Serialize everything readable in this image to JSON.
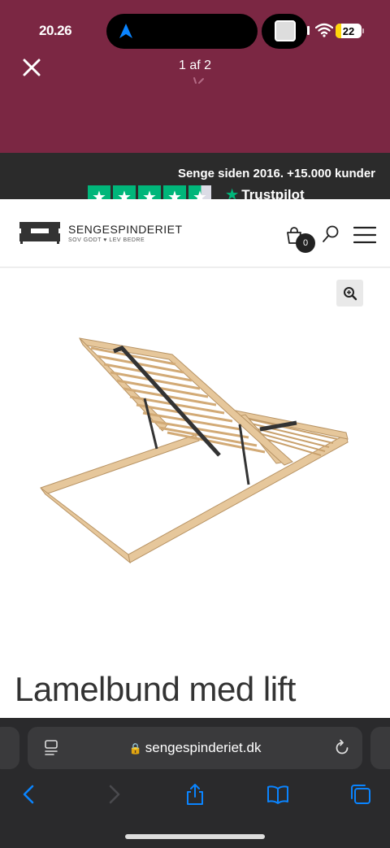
{
  "status_bar": {
    "time": "20.26",
    "battery": "22"
  },
  "viewer": {
    "counter": "1 af 2"
  },
  "promo": {
    "text": "Senge siden 2016. +15.000 kunder",
    "trustpilot": "Trustpilot"
  },
  "header": {
    "brand": "SENGESPINDERIET",
    "tagline": "SOV GODT ♥ LEV BEDRE",
    "cart_count": "0"
  },
  "product": {
    "title": "Lamelbund med lift"
  },
  "browser": {
    "url": "sengespinderiet.dk"
  },
  "colors": {
    "viewer_bg": "#7b2743",
    "promo_bg": "#2b2b2b",
    "trustpilot_green": "#00b67a",
    "ios_blue": "#0a84ff"
  }
}
